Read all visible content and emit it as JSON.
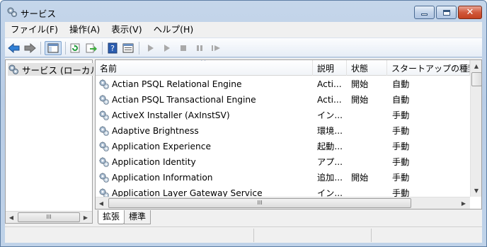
{
  "window": {
    "title": "サービス",
    "icon": "gears-icon",
    "controls": [
      "minimize",
      "maximize",
      "close"
    ]
  },
  "menu": {
    "items": [
      "ファイル(F)",
      "操作(A)",
      "表示(V)",
      "ヘルプ(H)"
    ]
  },
  "toolbar": {
    "buttons": [
      "back-icon",
      "forward-icon",
      "show-hide-tree-icon",
      "refresh-icon",
      "export-list-icon",
      "help-icon",
      "properties-icon",
      "start-icon",
      "start-alt-icon",
      "stop-icon",
      "pause-icon",
      "resume-icon"
    ]
  },
  "tree": {
    "root_label": "サービス (ローカル)",
    "hscroll_grip": "III"
  },
  "list": {
    "columns": [
      "名前",
      "説明",
      "状態",
      "スタートアップの種類"
    ],
    "sort_indicator": "^",
    "rows": [
      {
        "name": "Actian PSQL Relational Engine",
        "desc": "Acti...",
        "status": "開始",
        "startup": "自動"
      },
      {
        "name": "Actian PSQL Transactional Engine",
        "desc": "Acti...",
        "status": "開始",
        "startup": "自動"
      },
      {
        "name": "ActiveX Installer (AxInstSV)",
        "desc": "イン...",
        "status": "",
        "startup": "手動"
      },
      {
        "name": "Adaptive Brightness",
        "desc": "環境...",
        "status": "",
        "startup": "手動"
      },
      {
        "name": "Application Experience",
        "desc": "起動...",
        "status": "",
        "startup": "手動"
      },
      {
        "name": "Application Identity",
        "desc": "アプ...",
        "status": "",
        "startup": "手動"
      },
      {
        "name": "Application Information",
        "desc": "追加...",
        "status": "開始",
        "startup": "手動"
      },
      {
        "name": "Application Layer Gateway Service",
        "desc": "イン...",
        "status": "",
        "startup": "手動"
      }
    ],
    "hscroll_grip": "III"
  },
  "tabs": {
    "extended": "拡張",
    "standard": "標準"
  },
  "colors": {
    "window_frame": "#b9cde6",
    "close_button": "#c44120",
    "selection": "#e3e3e3"
  }
}
